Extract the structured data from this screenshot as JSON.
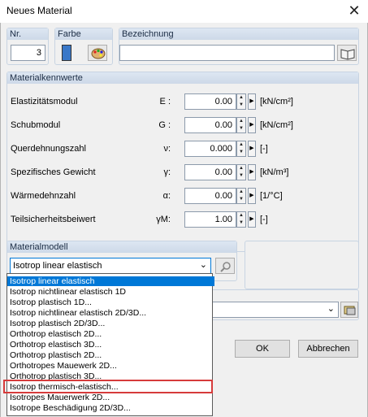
{
  "window": {
    "title": "Neues Material",
    "close_glyph": "✕"
  },
  "header": {
    "nr_label": "Nr.",
    "nr_value": "3",
    "farbe_label": "Farbe",
    "farbe_color": "#3a78c8",
    "bezeichnung_label": "Bezeichnung",
    "bezeichnung_value": ""
  },
  "kennwerte": {
    "title": "Materialkennwerte",
    "rows": [
      {
        "label": "Elastizitätsmodul",
        "symbol": "E :",
        "value": "0.00",
        "unit": "[kN/cm²]"
      },
      {
        "label": "Schubmodul",
        "symbol": "G :",
        "value": "0.00",
        "unit": "[kN/cm²]"
      },
      {
        "label": "Querdehnungszahl",
        "symbol": "ν:",
        "value": "0.000",
        "unit": "[-]"
      },
      {
        "label": "Spezifisches Gewicht",
        "symbol": "γ:",
        "value": "0.00",
        "unit": "[kN/m³]"
      },
      {
        "label": "Wärmedehnzahl",
        "symbol": "α:",
        "value": "0.00",
        "unit": "[1/°C]"
      },
      {
        "label": "Teilsicherheitsbeiwert",
        "symbol": "γM:",
        "value": "1.00",
        "unit": "[-]"
      }
    ]
  },
  "modell": {
    "title": "Materialmodell",
    "selected": "Isotrop linear elastisch",
    "options": [
      "Isotrop linear elastisch",
      "Isotrop nichtlinear elastisch 1D",
      "Isotrop plastisch 1D...",
      "Isotrop nichtlinear elastisch 2D/3D...",
      "Isotrop plastisch 2D/3D...",
      "Orthotrop elastisch 2D...",
      "Orthotrop elastisch 3D...",
      "Orthotrop plastisch 2D...",
      "Orthotropes Mauewerk 2D...",
      "Orthotrop plastisch 3D...",
      "Isotrop thermisch-elastisch...",
      "Isotropes Mauerwerk 2D...",
      "Isotrope Beschädigung 2D/3D..."
    ],
    "highlighted_index": 10
  },
  "buttons": {
    "ok": "OK",
    "cancel": "Abbrechen"
  }
}
